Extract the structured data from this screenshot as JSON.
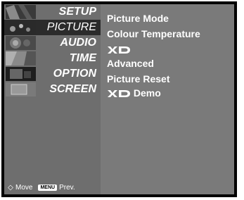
{
  "menu": {
    "items": [
      {
        "label": "SETUP",
        "selected": false,
        "thumb": "setup-thumb-icon"
      },
      {
        "label": "PICTURE",
        "selected": true,
        "thumb": "picture-thumb-icon"
      },
      {
        "label": "AUDIO",
        "selected": false,
        "thumb": "audio-thumb-icon"
      },
      {
        "label": "TIME",
        "selected": false,
        "thumb": "time-thumb-icon"
      },
      {
        "label": "OPTION",
        "selected": false,
        "thumb": "option-thumb-icon"
      },
      {
        "label": "SCREEN",
        "selected": false,
        "thumb": "screen-thumb-icon"
      }
    ]
  },
  "hint": {
    "move_label": "Move",
    "menu_key": "MENU",
    "prev_label": "Prev.",
    "move_icon": "diamond-arrows-icon"
  },
  "picture_menu": {
    "options": [
      {
        "label": "Picture Mode"
      },
      {
        "label": "Colour Temperature"
      },
      {
        "label": "",
        "logo": "xd-logo"
      },
      {
        "label": "Advanced"
      },
      {
        "label": "Picture Reset"
      },
      {
        "label": "Demo",
        "logo": "xd-logo"
      }
    ]
  },
  "colors": {
    "frame": "#000000",
    "sidebar": "#6e6e6e",
    "selected": "#2b2b2b",
    "content": "#7a7a7a",
    "text": "#ffffff"
  }
}
